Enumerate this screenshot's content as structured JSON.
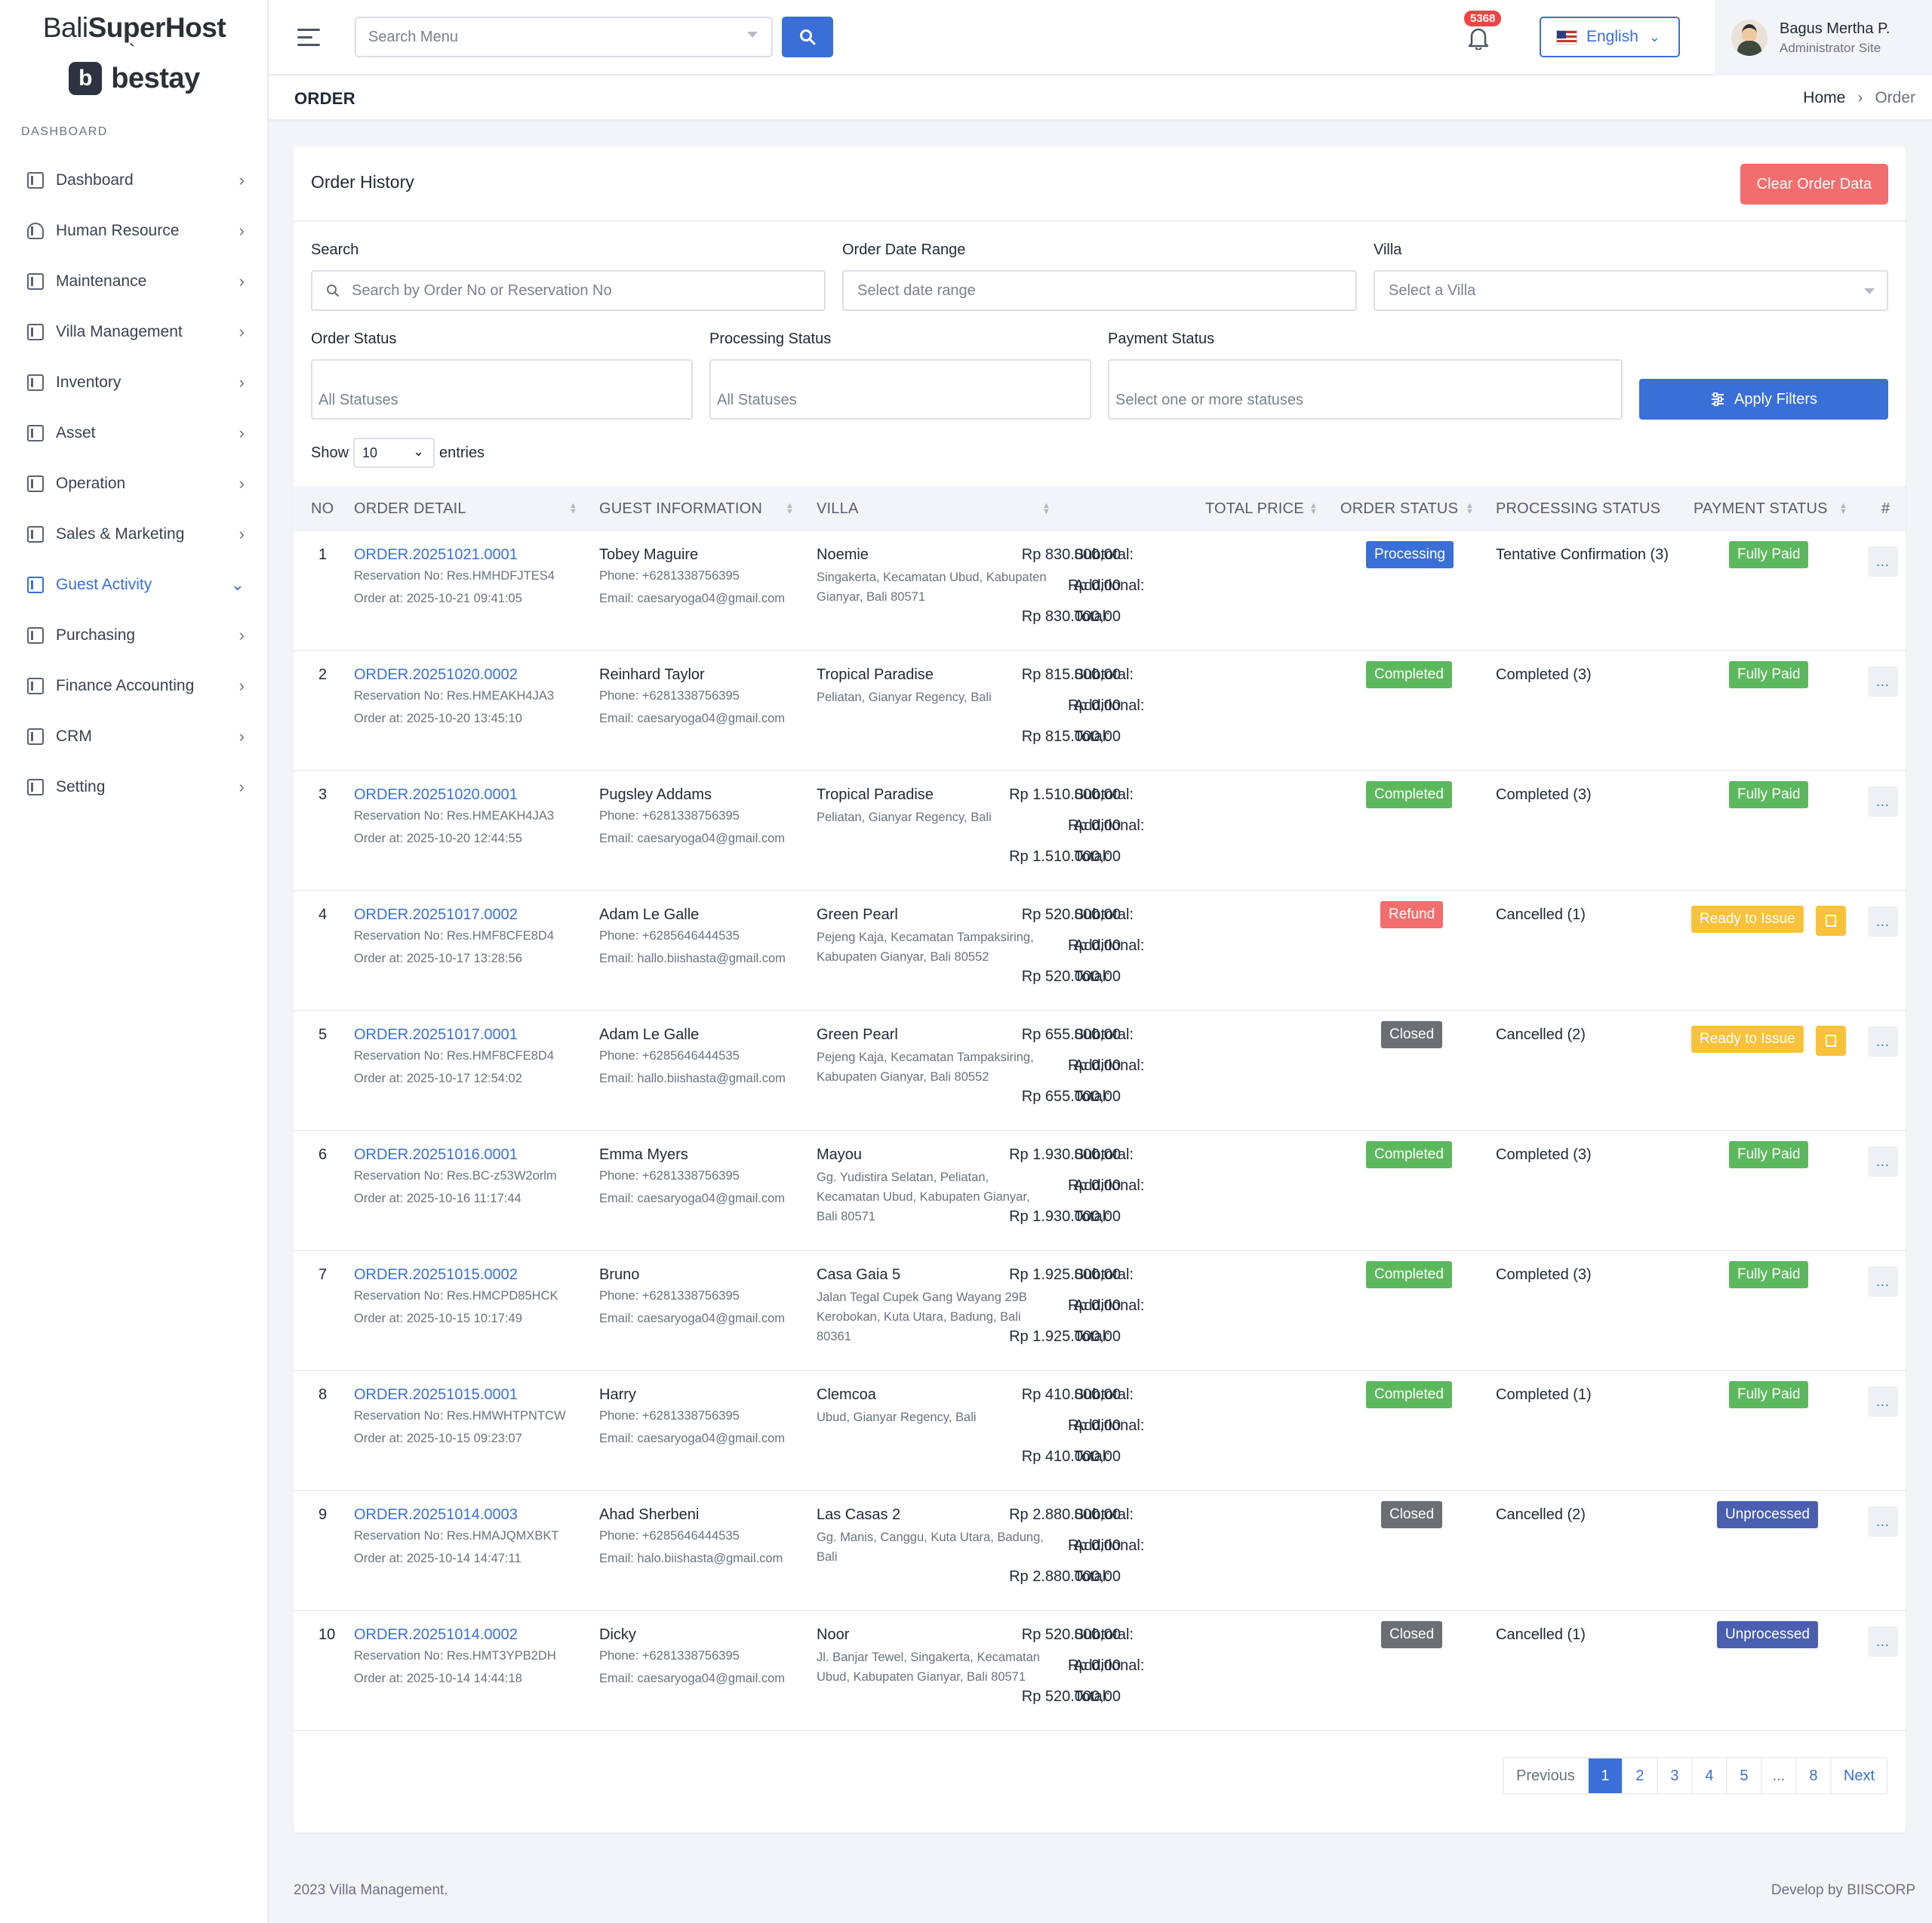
{
  "brand": {
    "top_light": "Bali",
    "top_bold": "SuperHost",
    "tick": "`",
    "logo_letter": "b",
    "name": "bestay"
  },
  "sidebar": {
    "section": "DASHBOARD",
    "items": [
      {
        "label": "Dashboard",
        "icon": "book-icon"
      },
      {
        "label": "Human Resource",
        "icon": "person-icon"
      },
      {
        "label": "Maintenance",
        "icon": "paint-roller-icon"
      },
      {
        "label": "Villa Management",
        "icon": "book-icon"
      },
      {
        "label": "Inventory",
        "icon": "book-icon"
      },
      {
        "label": "Asset",
        "icon": "book-icon"
      },
      {
        "label": "Operation",
        "icon": "book-icon"
      },
      {
        "label": "Sales & Marketing",
        "icon": "book-icon"
      },
      {
        "label": "Guest Activity",
        "icon": "book-icon",
        "active": true
      },
      {
        "label": "Purchasing",
        "icon": "wallet-icon"
      },
      {
        "label": "Finance Accounting",
        "icon": "book-icon"
      },
      {
        "label": "CRM",
        "icon": "book-icon"
      },
      {
        "label": "Setting",
        "icon": "tools-icon"
      }
    ]
  },
  "topbar": {
    "search_placeholder": "Search Menu",
    "notif_count": "5368",
    "language": "English",
    "user_name": "Bagus Mertha P.",
    "user_role": "Administrator Site"
  },
  "page": {
    "title": "ORDER",
    "breadcrumb_home": "Home",
    "breadcrumb_current": "Order"
  },
  "card": {
    "title": "Order History",
    "clear_button": "Clear Order Data",
    "filters": {
      "search_label": "Search",
      "search_placeholder": "Search by Order No or Reservation No",
      "date_label": "Order Date Range",
      "date_placeholder": "Select date range",
      "villa_label": "Villa",
      "villa_placeholder": "Select a Villa",
      "order_status_label": "Order Status",
      "order_status_value": "All Statuses",
      "processing_status_label": "Processing Status",
      "processing_status_value": "All Statuses",
      "payment_status_label": "Payment Status",
      "payment_status_value": "Select one or more statuses",
      "apply_button": "Apply Filters"
    },
    "show_label": "Show",
    "show_value": "10",
    "entries_label": "entries"
  },
  "table": {
    "headers": {
      "no": "NO",
      "order_detail": "ORDER DETAIL",
      "guest": "GUEST INFORMATION",
      "villa": "VILLA",
      "total": "TOTAL PRICE",
      "order_status": "ORDER STATUS",
      "processing": "PROCESSING STATUS",
      "payment": "PAYMENT STATUS",
      "action": "#"
    },
    "labels": {
      "subtotal": "Subtotal:",
      "additional": "Additional:",
      "total": "Total:",
      "more": "..."
    },
    "rows": [
      {
        "no": "1",
        "order": "ORDER.20251021.0001",
        "res": "Reservation No: Res.HMHDFJTES4",
        "at": "Order at: 2025-10-21 09:41:05",
        "guest": "Tobey Maguire",
        "phone": "Phone: +6281338756395",
        "email": "Email: caesaryoga04@gmail.com",
        "villa": "Noemie",
        "addr": "Singakerta, Kecamatan Ubud, Kabupaten Gianyar, Bali 80571",
        "subtotal": "Rp 830.000,00",
        "additional": "Rp 0,00",
        "total": "Rp 830.000,00",
        "ostatus": "Processing",
        "otype": "processing",
        "proc": "Tentative Confirmation (3)",
        "pay": "Fully Paid",
        "ptype": "paid"
      },
      {
        "no": "2",
        "order": "ORDER.20251020.0002",
        "res": "Reservation No: Res.HMEAKH4JA3",
        "at": "Order at: 2025-10-20 13:45:10",
        "guest": "Reinhard Taylor",
        "phone": "Phone: +6281338756395",
        "email": "Email: caesaryoga04@gmail.com",
        "villa": "Tropical Paradise",
        "addr": "Peliatan, Gianyar Regency, Bali",
        "subtotal": "Rp 815.000,00",
        "additional": "Rp 0,00",
        "total": "Rp 815.000,00",
        "ostatus": "Completed",
        "otype": "completed",
        "proc": "Completed (3)",
        "pay": "Fully Paid",
        "ptype": "paid"
      },
      {
        "no": "3",
        "order": "ORDER.20251020.0001",
        "res": "Reservation No: Res.HMEAKH4JA3",
        "at": "Order at: 2025-10-20 12:44:55",
        "guest": "Pugsley Addams",
        "phone": "Phone: +6281338756395",
        "email": "Email: caesaryoga04@gmail.com",
        "villa": "Tropical Paradise",
        "addr": "Peliatan, Gianyar Regency, Bali",
        "subtotal": "Rp 1.510.000,00",
        "additional": "Rp 0,00",
        "total": "Rp 1.510.000,00",
        "ostatus": "Completed",
        "otype": "completed",
        "proc": "Completed (3)",
        "pay": "Fully Paid",
        "ptype": "paid"
      },
      {
        "no": "4",
        "order": "ORDER.20251017.0002",
        "res": "Reservation No: Res.HMF8CFE8D4",
        "at": "Order at: 2025-10-17 13:28:56",
        "guest": "Adam Le Galle",
        "phone": "Phone: +6285646444535",
        "email": "Email: hallo.biishasta@gmail.com",
        "villa": "Green Pearl",
        "addr": "Pejeng Kaja, Kecamatan Tampaksiring, Kabupaten Gianyar, Bali 80552",
        "subtotal": "Rp 520.000,00",
        "additional": "Rp 0,00",
        "total": "Rp 520.000,00",
        "ostatus": "Refund",
        "otype": "refund",
        "proc": "Cancelled (1)",
        "pay": "Ready to Issue",
        "ptype": "ready"
      },
      {
        "no": "5",
        "order": "ORDER.20251017.0001",
        "res": "Reservation No: Res.HMF8CFE8D4",
        "at": "Order at: 2025-10-17 12:54:02",
        "guest": "Adam Le Galle",
        "phone": "Phone: +6285646444535",
        "email": "Email: hallo.biishasta@gmail.com",
        "villa": "Green Pearl",
        "addr": "Pejeng Kaja, Kecamatan Tampaksiring, Kabupaten Gianyar, Bali 80552",
        "subtotal": "Rp 655.000,00",
        "additional": "Rp 0,00",
        "total": "Rp 655.000,00",
        "ostatus": "Closed",
        "otype": "closed",
        "proc": "Cancelled (2)",
        "pay": "Ready to Issue",
        "ptype": "ready"
      },
      {
        "no": "6",
        "order": "ORDER.20251016.0001",
        "res": "Reservation No: Res.BC-z53W2orlm",
        "at": "Order at: 2025-10-16 11:17:44",
        "guest": "Emma Myers",
        "phone": "Phone: +6281338756395",
        "email": "Email: caesaryoga04@gmail.com",
        "villa": "Mayou",
        "addr": "Gg. Yudistira Selatan, Peliatan, Kecamatan Ubud, Kabupaten Gianyar, Bali 80571",
        "subtotal": "Rp 1.930.000,00",
        "additional": "Rp 0,00",
        "total": "Rp 1.930.000,00",
        "ostatus": "Completed",
        "otype": "completed",
        "proc": "Completed (3)",
        "pay": "Fully Paid",
        "ptype": "paid"
      },
      {
        "no": "7",
        "order": "ORDER.20251015.0002",
        "res": "Reservation No: Res.HMCPD85HCK",
        "at": "Order at: 2025-10-15 10:17:49",
        "guest": "Bruno",
        "phone": "Phone: +6281338756395",
        "email": "Email: caesaryoga04@gmail.com",
        "villa": "Casa Gaia 5",
        "addr": "Jalan Tegal Cupek Gang Wayang 29B Kerobokan, Kuta Utara, Badung, Bali 80361",
        "subtotal": "Rp 1.925.000,00",
        "additional": "Rp 0,00",
        "total": "Rp 1.925.000,00",
        "ostatus": "Completed",
        "otype": "completed",
        "proc": "Completed (3)",
        "pay": "Fully Paid",
        "ptype": "paid"
      },
      {
        "no": "8",
        "order": "ORDER.20251015.0001",
        "res": "Reservation No: Res.HMWHTPNTCW",
        "at": "Order at: 2025-10-15 09:23:07",
        "guest": "Harry",
        "phone": "Phone: +6281338756395",
        "email": "Email: caesaryoga04@gmail.com",
        "villa": "Clemcoa",
        "addr": "Ubud, Gianyar Regency, Bali",
        "subtotal": "Rp 410.000,00",
        "additional": "Rp 0,00",
        "total": "Rp 410.000,00",
        "ostatus": "Completed",
        "otype": "completed",
        "proc": "Completed (1)",
        "pay": "Fully Paid",
        "ptype": "paid"
      },
      {
        "no": "9",
        "order": "ORDER.20251014.0003",
        "res": "Reservation No: Res.HMAJQMXBKT",
        "at": "Order at: 2025-10-14 14:47:11",
        "guest": "Ahad Sherbeni",
        "phone": "Phone: +6285646444535",
        "email": "Email: halo.biishasta@gmail.com",
        "villa": "Las Casas 2",
        "addr": "Gg. Manis, Canggu, Kuta Utara, Badung, Bali",
        "subtotal": "Rp 2.880.000,00",
        "additional": "Rp 0,00",
        "total": "Rp 2.880.000,00",
        "ostatus": "Closed",
        "otype": "closed",
        "proc": "Cancelled (2)",
        "pay": "Unprocessed",
        "ptype": "unproc"
      },
      {
        "no": "10",
        "order": "ORDER.20251014.0002",
        "res": "Reservation No: Res.HMT3YPB2DH",
        "at": "Order at: 2025-10-14 14:44:18",
        "guest": "Dicky",
        "phone": "Phone: +6281338756395",
        "email": "Email: caesaryoga04@gmail.com",
        "villa": "Noor",
        "addr": "Jl. Banjar Tewel, Singakerta, Kecamatan Ubud, Kabupaten Gianyar, Bali 80571",
        "subtotal": "Rp 520.000,00",
        "additional": "Rp 0,00",
        "total": "Rp 520.000,00",
        "ostatus": "Closed",
        "otype": "closed",
        "proc": "Cancelled (1)",
        "pay": "Unprocessed",
        "ptype": "unproc"
      }
    ]
  },
  "pagination": {
    "previous": "Previous",
    "pages": [
      "1",
      "2",
      "3",
      "4",
      "5",
      "...",
      "8"
    ],
    "active": "1",
    "next": "Next"
  },
  "footer": {
    "left": "2023 Villa Management.",
    "right": "Develop by BIISCORP"
  },
  "colors": {
    "primary": "#3a6fd8",
    "success": "#5cb85c",
    "danger": "#f26d6d",
    "warning": "#f9c23c",
    "dark": "#6b6e73",
    "indigo": "#4a5fb0"
  }
}
